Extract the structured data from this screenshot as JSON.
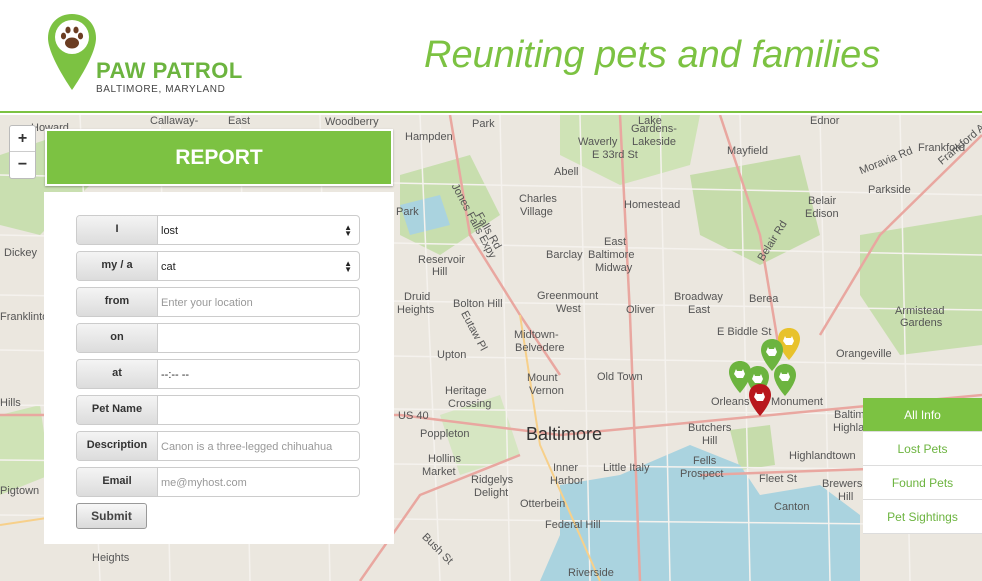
{
  "header": {
    "logo_title": "PAW PATROL",
    "logo_subtitle": "BALTIMORE, MARYLAND",
    "tagline": "Reuniting pets and families"
  },
  "zoom": {
    "in_label": "+",
    "out_label": "−"
  },
  "report": {
    "title": "REPORT",
    "fields": [
      {
        "label": "I",
        "value": "lost",
        "type": "select"
      },
      {
        "label": "my / a",
        "value": "cat",
        "type": "select"
      },
      {
        "label": "from",
        "placeholder": "Enter your location",
        "type": "text"
      },
      {
        "label": "on",
        "value": "",
        "type": "date"
      },
      {
        "label": "at",
        "value": "--:-- --",
        "type": "time"
      },
      {
        "label": "Pet Name",
        "value": "",
        "type": "text"
      },
      {
        "label": "Description",
        "placeholder": "Canon is a three-legged chihuahua",
        "type": "text"
      },
      {
        "label": "Email",
        "placeholder": "me@myhost.com",
        "type": "email"
      }
    ],
    "submit_label": "Submit"
  },
  "filters": [
    {
      "label": "All Info",
      "active": true
    },
    {
      "label": "Lost Pets",
      "active": false
    },
    {
      "label": "Found Pets",
      "active": false
    },
    {
      "label": "Pet Sightings",
      "active": false
    }
  ],
  "map": {
    "city_label": "Baltimore",
    "labels": [
      "Howard",
      "Callaway-",
      "East",
      "Woodberry",
      "Park",
      "Hampden",
      "Waverly",
      "E 33rd St",
      "Lake",
      "Gardens-",
      "Lakeside",
      "Mayfield",
      "Ednor",
      "Moravia Rd",
      "Frankford Ave",
      "Frankford",
      "Belair",
      "Parkside",
      "Edison",
      "Belair Rd",
      "Abell",
      "Homestead",
      "Charles",
      "Village",
      "Park",
      "Jones Falls Expy",
      "Falls Rd",
      "East",
      "Barclay",
      "Baltimore",
      "Midway",
      "Reservoir",
      "Hill",
      "Druid",
      "Heights",
      "Bolton Hill",
      "Eutaw Pl",
      "Greenmount",
      "West",
      "Broadway",
      "East",
      "Oliver",
      "Berea",
      "Armistead",
      "Gardens",
      "E Biddle St",
      "Midtown-",
      "Belvedere",
      "Upton",
      "Orangeville",
      "Old Town",
      "Mount",
      "Vernon",
      "Heritage",
      "Crossing",
      "Poppleton",
      "Orleans",
      "Monument",
      "Baltimore",
      "Highlands",
      "Butchers",
      "Hill",
      "Little Italy",
      "Fells",
      "Prospect",
      "Highlandtown",
      "Hollins",
      "Market",
      "Ridgelys",
      "Delight",
      "Inner",
      "Harbor",
      "Fleet St",
      "Brewers",
      "Hill",
      "Otterbein",
      "Canton",
      "Federal Hill",
      "Riverside",
      "Bush St",
      "Dickey",
      "Franklinto",
      "Hills",
      "US 40",
      "Heights",
      "Pigtown"
    ],
    "markers": [
      {
        "color": "#e8c22b",
        "kind": "sighting"
      },
      {
        "color": "#6cb43f",
        "kind": "found"
      },
      {
        "color": "#6cb43f",
        "kind": "found"
      },
      {
        "color": "#6cb43f",
        "kind": "found"
      },
      {
        "color": "#6cb43f",
        "kind": "found"
      },
      {
        "color": "#b8171d",
        "kind": "lost"
      }
    ]
  },
  "colors": {
    "brand": "#7cc242",
    "lost": "#b8171d",
    "sighting": "#e8c22b",
    "map_bg": "#ebe7df"
  }
}
